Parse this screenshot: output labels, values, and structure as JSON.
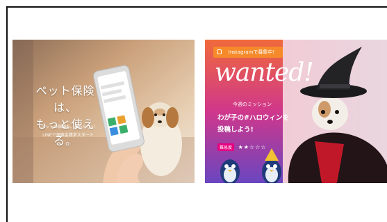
{
  "left_banner": {
    "title_line1": "ペット保険は、",
    "title_line2": "もっと使える。",
    "subtitle_line1": "ペットの保険も、あたらしい",
    "subtitle_line2": "LINEで保険金請求スタート"
  },
  "right_banner": {
    "instagram_label": "Instagramで募集中!",
    "headline": "wanted!",
    "mission_label": "今週のミッション",
    "mission_line1": "わが子の#ハロウィンを",
    "mission_line2": "投稿しよう!",
    "difficulty_label": "難易度",
    "difficulty_stars": "★★☆☆☆"
  },
  "colors": {
    "gradient_top": "#f06a3b",
    "gradient_mid": "#d0378b",
    "gradient_bottom": "#6a46c0",
    "instagram_bar": "#f68a2a",
    "badge_pink": "#e6007e"
  },
  "icons": [
    "instagram-icon",
    "smartphone-icon",
    "dog-photo",
    "witch-hat-dog-photo",
    "penguin-mascot-icon"
  ]
}
